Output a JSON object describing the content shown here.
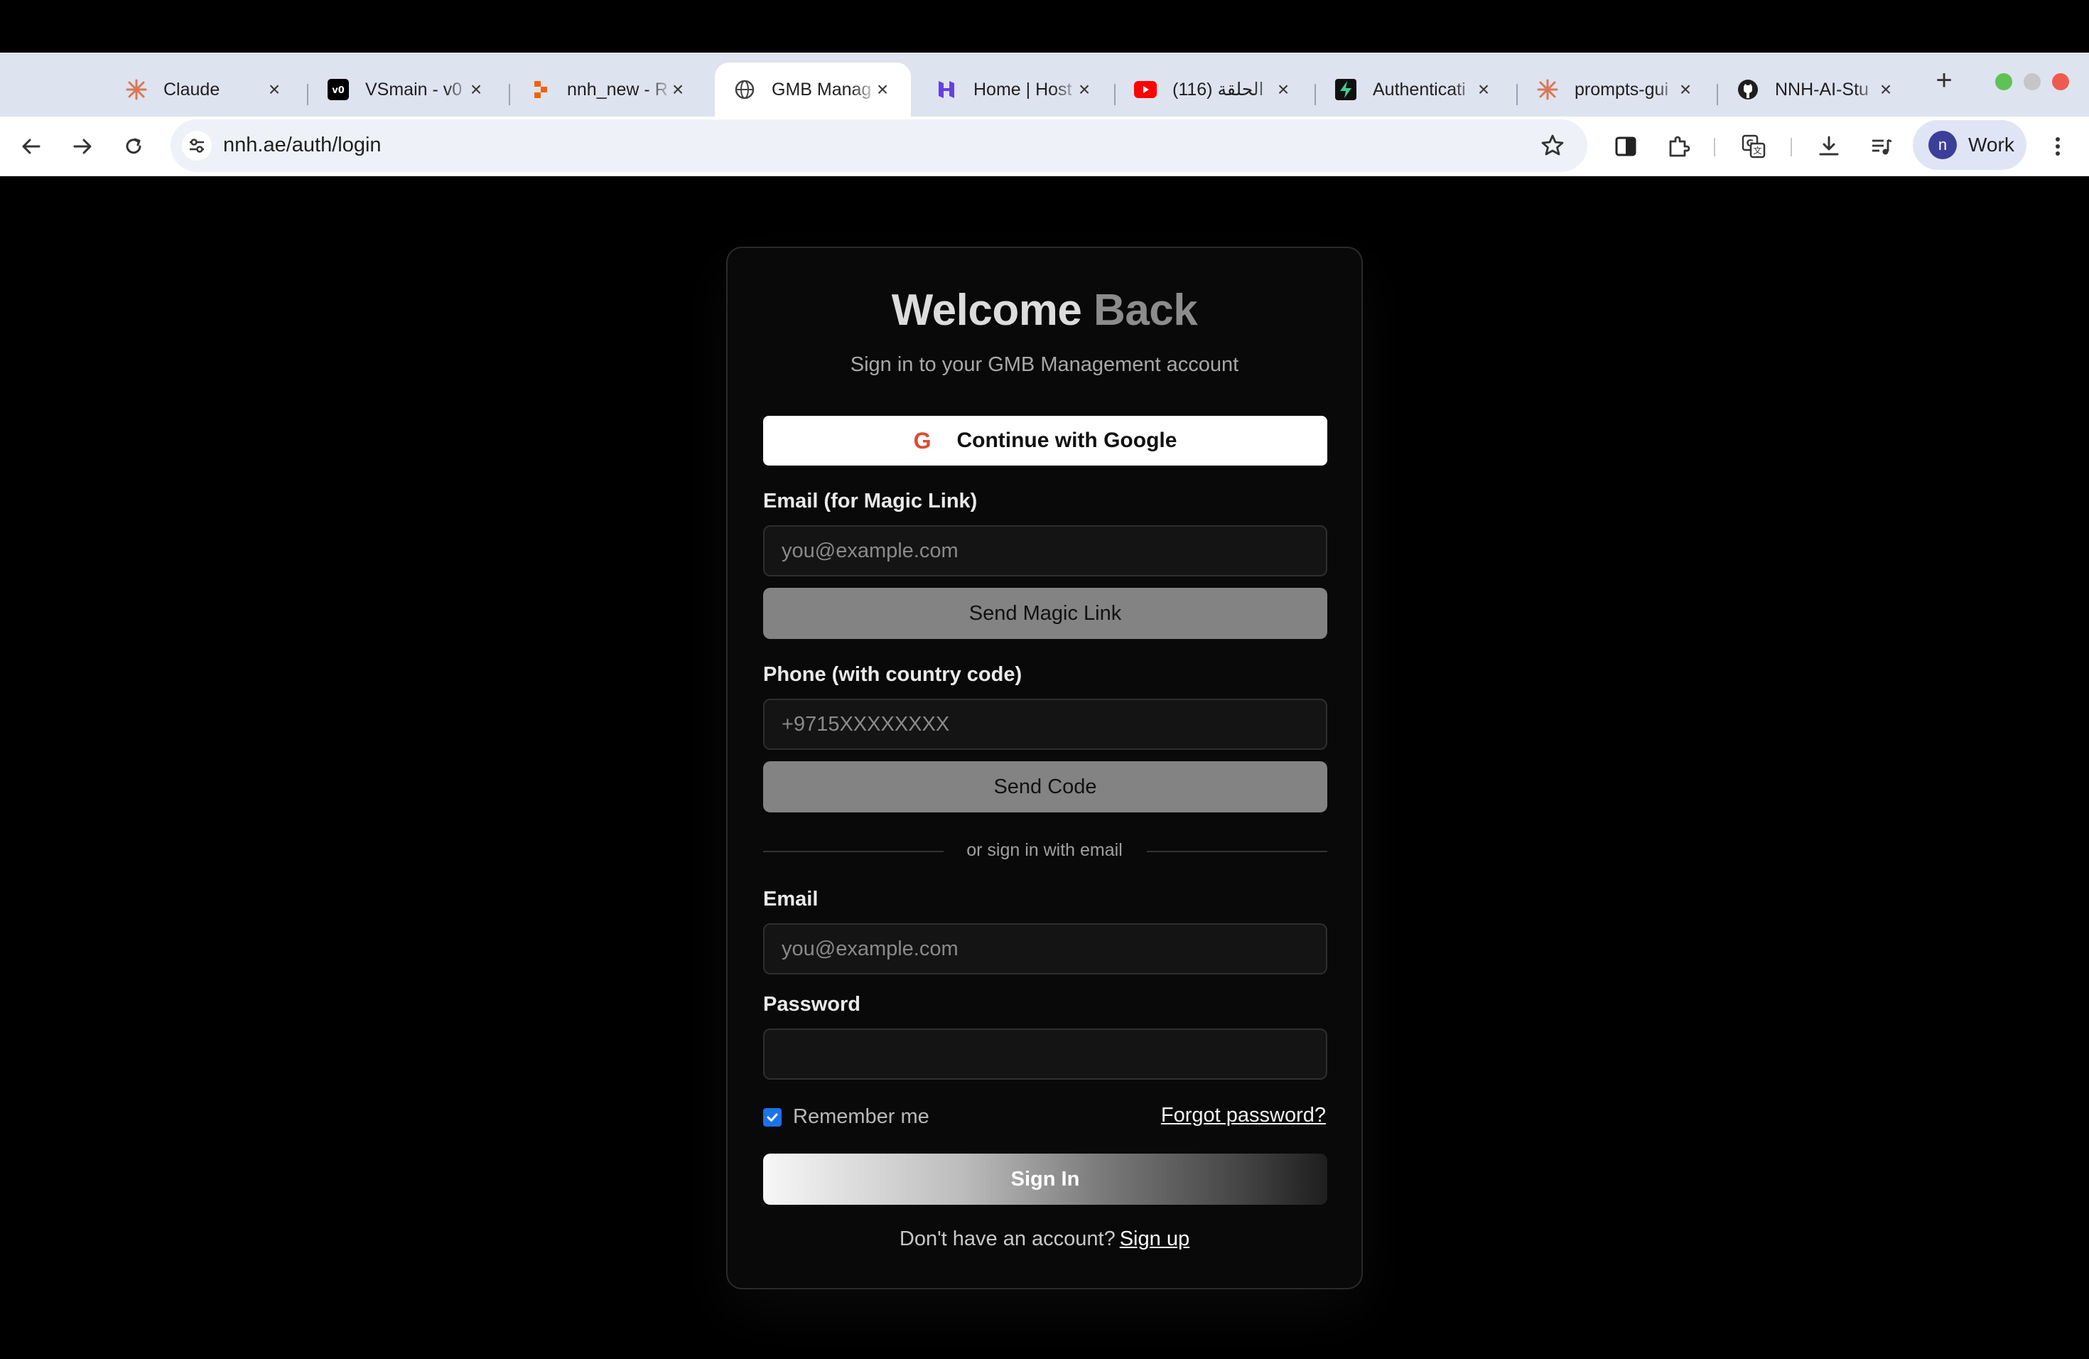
{
  "browser": {
    "tabs": [
      {
        "title": "Claude",
        "icon": "claude-icon"
      },
      {
        "title": "VSmain - v0",
        "icon": "v0-icon"
      },
      {
        "title": "nnh_new - R",
        "icon": "replit-icon"
      },
      {
        "title": "GMB Manag",
        "icon": "globe-icon",
        "active": true
      },
      {
        "title": "Home | Host",
        "icon": "hostinger-icon"
      },
      {
        "title": "(116) الحلقة",
        "icon": "youtube-icon"
      },
      {
        "title": "Authenticati",
        "icon": "supabase-icon"
      },
      {
        "title": "prompts-gui",
        "icon": "claude-icon"
      },
      {
        "title": "NNH-AI-Stu",
        "icon": "github-icon"
      }
    ],
    "url": "nnh.ae/auth/login",
    "profile": {
      "initial": "n",
      "name": "Work"
    }
  },
  "login": {
    "title_part1": "Welcome",
    "title_part2": "Back",
    "subtitle": "Sign in to your GMB Management account",
    "google_button": "Continue with Google",
    "magic_label": "Email (for Magic Link)",
    "magic_placeholder": "you@example.com",
    "magic_button": "Send Magic Link",
    "phone_label": "Phone (with country code)",
    "phone_placeholder": "+9715XXXXXXXX",
    "phone_button": "Send Code",
    "divider": "or sign in with email",
    "email_label": "Email",
    "email_placeholder": "you@example.com",
    "password_label": "Password",
    "remember": "Remember me",
    "remember_checked": true,
    "forgot": "Forgot password?",
    "signin_button": "Sign In",
    "no_account": "Don't have an account?",
    "signup": "Sign up"
  },
  "colors": {
    "page_bg": "#000000",
    "card_bg": "#090909",
    "accent_checkbox": "#1a73e8",
    "secondary_button": "#838383"
  }
}
